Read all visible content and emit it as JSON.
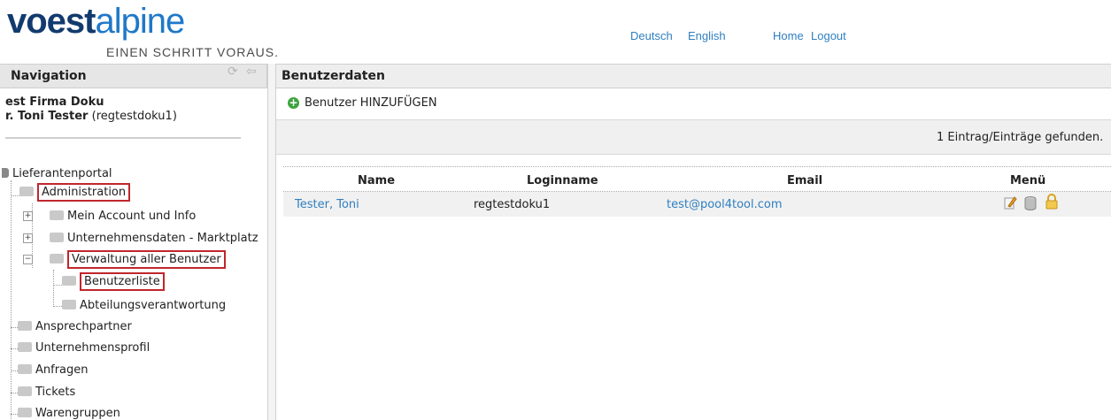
{
  "header": {
    "logo_part1": "voest",
    "logo_part2": "alpine",
    "tagline": "EINEN SCHRITT VORAUS.",
    "links": [
      "Deutsch",
      "English",
      "Home",
      "Logout"
    ]
  },
  "nav": {
    "title": "Navigation",
    "company": "est Firma Doku",
    "user_name": "r. Toni Tester",
    "user_login": "(regtestdoku1)",
    "tree": {
      "root": "Lieferantenportal",
      "administration": "Administration",
      "mein_account": "Mein Account und Info",
      "unternehmensdaten": "Unternehmensdaten - Marktplatz",
      "verwaltung": "Verwaltung aller Benutzer",
      "benutzerliste": "Benutzerliste",
      "abteilung": "Abteilungsverantwortung",
      "ansprechpartner": "Ansprechpartner",
      "unternehmensprofil": "Unternehmensprofil",
      "anfragen": "Anfragen",
      "tickets": "Tickets",
      "warengruppen": "Warengruppen"
    },
    "icons": [
      "collapse-arrows-icon",
      "back-arrow-icon"
    ]
  },
  "main": {
    "title": "Benutzerdaten",
    "add_user_label": "Benutzer HINZUFÜGEN",
    "found_text": "1 Eintrag/Einträge gefunden.",
    "columns": [
      "Name",
      "Loginname",
      "Email",
      "Menü"
    ],
    "rows": [
      {
        "name": "Tester, Toni",
        "login": "regtestdoku1",
        "email": "test@pool4tool.com"
      }
    ]
  },
  "colors": {
    "link": "#2f7fbf",
    "highlight_box": "#c0262c",
    "logo_dark": "#123a6e",
    "logo_light": "#1f78c8"
  }
}
